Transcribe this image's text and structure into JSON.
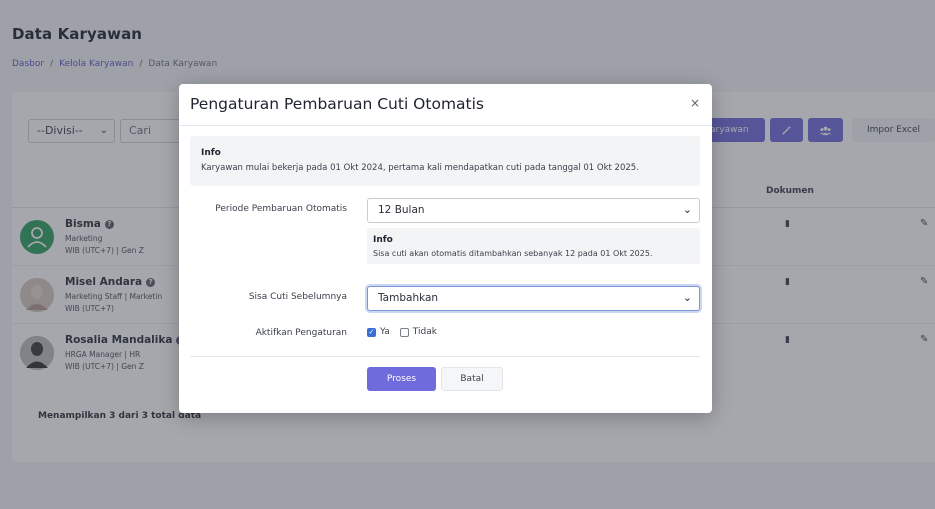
{
  "page": {
    "title": "Data Karyawan",
    "breadcrumb": [
      "Dasbor",
      "Kelola Karyawan",
      "Data Karyawan"
    ],
    "breadcrumb_sep": "/"
  },
  "toolbar": {
    "divisi_value": "--Divisi--",
    "search_placeholder": "Cari",
    "add_label": "aryawan",
    "import_label": "Impor Excel"
  },
  "table": {
    "dokumen_header": "Dokumen",
    "employees": [
      {
        "name": "Bisma",
        "line1": "Marketing",
        "line2": "WIB (UTC+7) | Gen Z"
      },
      {
        "name": "Misel Andara",
        "line1": "Marketing Staff | Marketin",
        "line2": "WIB (UTC+7)"
      },
      {
        "name": "Rosalia Mandalika",
        "line1": "HRGA Manager | HR",
        "line2": "WIB (UTC+7) | Gen Z"
      }
    ],
    "summary": "Menampilkan 3 dari 3 total data"
  },
  "modal": {
    "title": "Pengaturan Pembaruan Cuti Otomatis",
    "close": "×",
    "info_title": "Info",
    "info_text": "Karyawan mulai bekerja pada 01 Okt 2024, pertama kali mendapatkan cuti pada tanggal 01 Okt 2025.",
    "periode_label": "Periode Pembaruan Otomatis",
    "periode_value": "12 Bulan",
    "periode_info_title": "Info",
    "periode_info_text": "Sisa cuti akan otomatis ditambahkan sebanyak 12 pada 01 Okt 2025.",
    "sisa_label": "Sisa Cuti Sebelumnya",
    "sisa_value": "Tambahkan",
    "aktif_label": "Aktifkan Pengaturan",
    "opt_ya": "Ya",
    "opt_tidak": "Tidak",
    "ya_checked": true,
    "tidak_checked": false,
    "proses_label": "Proses",
    "batal_label": "Batal"
  },
  "colors": {
    "accent": "#6f6bdc",
    "checkbox": "#3b6fd8"
  }
}
